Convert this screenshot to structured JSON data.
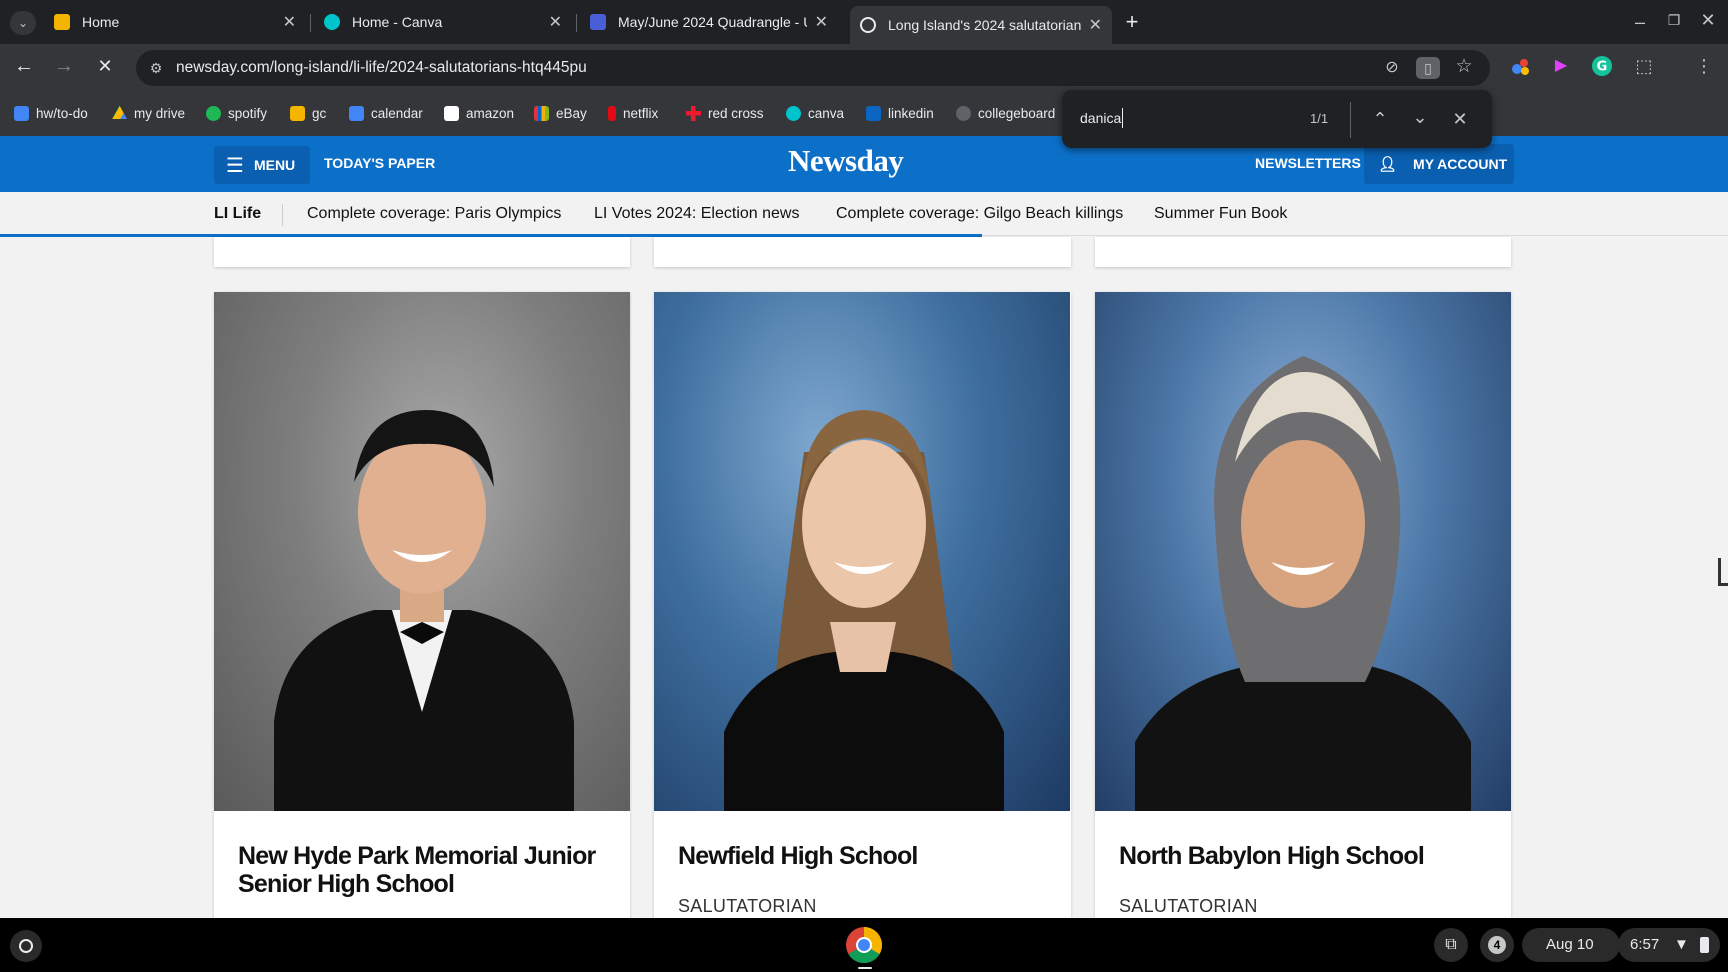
{
  "tabs": [
    {
      "title": "Home",
      "fav": "#f4b400"
    },
    {
      "title": "Home - Canva",
      "fav": "#00c4cc"
    },
    {
      "title": "May/June 2024 Quadrangle - U",
      "fav": "#4a5fd6"
    },
    {
      "title": "Long Island's 2024 salutatorian",
      "fav": "#ffffff"
    }
  ],
  "address": {
    "url": "newsday.com/long-island/li-life/2024-salutatorians-htq445pu"
  },
  "bookmarks": [
    "hw/to-do",
    "my drive",
    "spotify",
    "gc",
    "calendar",
    "amazon",
    "eBay",
    "netflix",
    "red cross",
    "canva",
    "linkedin",
    "collegeboard"
  ],
  "find": {
    "query": "danica",
    "count": "1/1"
  },
  "newsday": {
    "menu": "MENU",
    "todays_paper": "TODAY'S PAPER",
    "logo": "Newsday",
    "newsletters": "NEWSLETTERS",
    "my_account": "MY ACCOUNT",
    "sub_nav": [
      "LI Life",
      "Complete coverage: Paris Olympics",
      "LI Votes 2024: Election news",
      "Complete coverage: Gilgo Beach killings",
      "Summer Fun Book"
    ]
  },
  "cards": [
    {
      "school": "New Hyde Park Memorial Junior Senior High School",
      "role": ""
    },
    {
      "school": "Newfield High School",
      "role": "SALUTATORIAN"
    },
    {
      "school": "North Babylon High School",
      "role": "SALUTATORIAN"
    }
  ],
  "shelf": {
    "notifications": "4",
    "date": "Aug 10",
    "time": "6:57"
  },
  "colors": {
    "newsday_blue": "#0c70c9",
    "chrome_dark": "#202124",
    "chrome_mid": "#35363a"
  }
}
